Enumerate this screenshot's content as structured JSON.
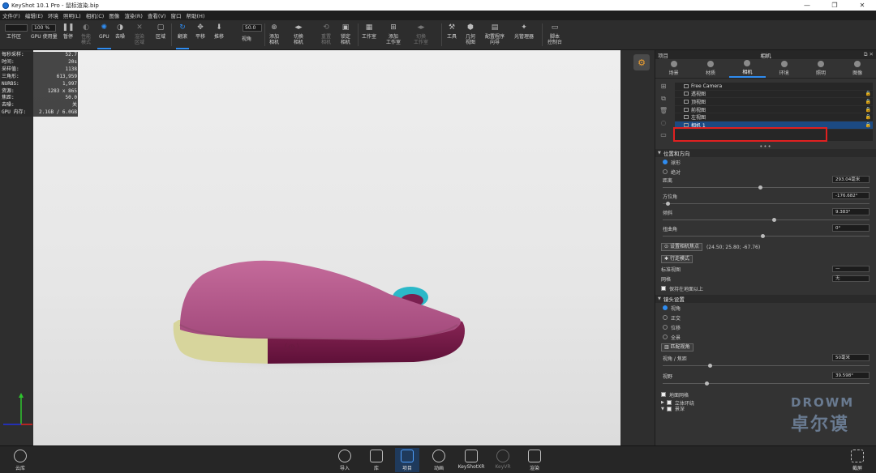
{
  "titlebar": {
    "title": "KeyShot 10.1 Pro - 鼠标渲染.bip",
    "min": "—",
    "restore": "❐",
    "close": "✕"
  },
  "menu": [
    "文件(F)",
    "编辑(E)",
    "环境",
    "照明(L)",
    "相机(C)",
    "图像",
    "渲染(R)",
    "查看(V)",
    "窗口",
    "帮助(H)"
  ],
  "toolbar": {
    "workspace": "工作区",
    "zoom_value": "100 %",
    "gpu_usage": "GPU 使用量",
    "pause": "暂停",
    "perf_mode": "性能\n模式",
    "gpu": "GPU",
    "denoise": "去噪",
    "render_region": "渲染\n区域",
    "region": "区域",
    "tumble": "翻滚",
    "pan": "平移",
    "dolly": "推移",
    "fov_value": "50.0",
    "fov": "视角",
    "add_camera": "添加\n相机",
    "switch_camera": "切换\n相机",
    "reset_camera": "重置\n相机",
    "lock_camera": "锁定\n相机",
    "studio": "工作室",
    "add_studio": "添加\n工作室",
    "switch_studio": "切换\n工作室",
    "tools": "工具",
    "geometry_view": "几何\n视图",
    "config_wizard": "配置程序\n向导",
    "light_manager": "光管理器",
    "script_console": "脚本\n控制台"
  },
  "stats": [
    {
      "k": "每秒采样:",
      "v": "52.7"
    },
    {
      "k": "时间:",
      "v": "20s"
    },
    {
      "k": "采样值:",
      "v": "1138"
    },
    {
      "k": "三角形:",
      "v": "613,959"
    },
    {
      "k": "NURBS:",
      "v": "1,997"
    },
    {
      "k": "资源:",
      "v": "1283 x 865"
    },
    {
      "k": "焦距:",
      "v": "50.0"
    },
    {
      "k": "去噪:",
      "v": "关"
    },
    {
      "k": "GPU 内存:",
      "v": "2.1GB / 6.0GB"
    }
  ],
  "mouse": {
    "logo": "(⊕)"
  },
  "panel": {
    "project": "项目",
    "header": "相机",
    "ctrls": "⧉ ✕",
    "tabs": [
      {
        "label": "场景"
      },
      {
        "label": "材质"
      },
      {
        "label": "相机"
      },
      {
        "label": "环境"
      },
      {
        "label": "照明"
      },
      {
        "label": "图像"
      }
    ],
    "cameras": [
      "Free Camera",
      "透视图",
      "顶视图",
      "前视图",
      "左视图",
      "相机 1"
    ],
    "dots": "•••",
    "section_pos": "位置和方向",
    "radio_orbit": "球形",
    "radio_absolute": "绝对",
    "distance_label": "距离",
    "distance_value": "293.04毫米",
    "azimuth_label": "方位角",
    "azimuth_value": "-176.682°",
    "incl_label": "倾斜",
    "incl_value": "9.383°",
    "twist_label": "扭曲角",
    "twist_value": "0°",
    "set_focus_btn": "设置相机焦点",
    "focus_coords": "(24.50; 25.80; -67.76)",
    "walk_btn": "行走模式",
    "std_view_label": "标准视图",
    "std_view_value": "—",
    "grid_label": "网格",
    "grid_value": "无",
    "keep_ground": "保持在地面以上",
    "section_lens": "镜头设置",
    "lens_persp": "视角",
    "lens_ortho": "正交",
    "lens_shift": "位移",
    "lens_pano": "全景",
    "match_btn": "匹配视角",
    "focal_label": "视角 / 焦距",
    "focal_value": "50毫米",
    "fov_label": "视野",
    "fov_value": "39.598°",
    "ground_grid": "地面网格",
    "stereo": "立体环绕",
    "dof": "景深"
  },
  "bottom": {
    "cloud": "云库",
    "import": "导入",
    "library": "库",
    "project": "项目",
    "animation": "动画",
    "keyshotxr": "KeyShotXR",
    "keyvr": "KeyVR",
    "render": "渲染",
    "screenshot": "截屏"
  },
  "watermark": {
    "en": "DROWM",
    "cn": "卓尔谟"
  },
  "colors": {
    "accent": "#2f8cf0",
    "mouse_top": "#b9588c",
    "mouse_base": "#7a1a4a",
    "mouse_side": "#d6d49a",
    "wheel": "#2bb8c8",
    "highlight": "#e02020"
  }
}
